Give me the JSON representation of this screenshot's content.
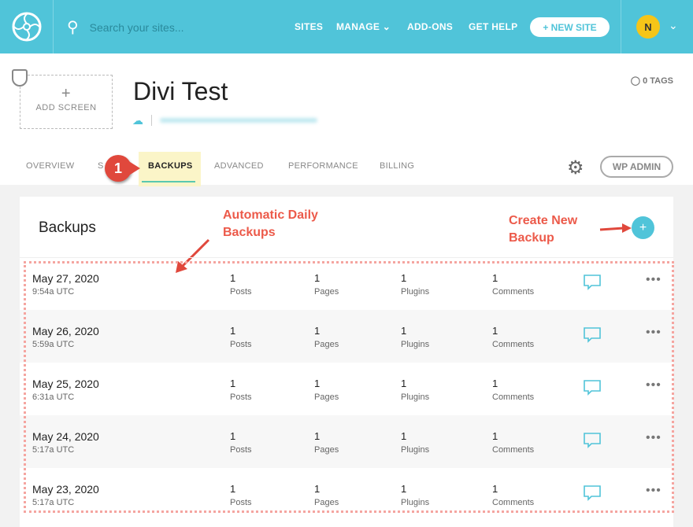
{
  "header": {
    "search_placeholder": "Search your sites...",
    "nav": [
      "SITES",
      "MANAGE",
      "ADD-ONS",
      "GET HELP"
    ],
    "new_site": "+ NEW SITE",
    "avatar": "N"
  },
  "site": {
    "add_screen": "ADD SCREEN",
    "title": "Divi Test",
    "tags": "0 TAGS"
  },
  "tabs": [
    "OVERVIEW",
    "S",
    "BACKUPS",
    "ADVANCED",
    "PERFORMANCE",
    "BILLING"
  ],
  "active_tab": "BACKUPS",
  "wp_admin": "WP ADMIN",
  "backups": {
    "title": "Backups",
    "rows": [
      {
        "date": "May 27, 2020",
        "time": "9:54a UTC",
        "posts": "1",
        "pages": "1",
        "plugins": "1",
        "comments": "1"
      },
      {
        "date": "May 26, 2020",
        "time": "5:59a UTC",
        "posts": "1",
        "pages": "1",
        "plugins": "1",
        "comments": "1"
      },
      {
        "date": "May 25, 2020",
        "time": "6:31a UTC",
        "posts": "1",
        "pages": "1",
        "plugins": "1",
        "comments": "1"
      },
      {
        "date": "May 24, 2020",
        "time": "5:17a UTC",
        "posts": "1",
        "pages": "1",
        "plugins": "1",
        "comments": "1"
      },
      {
        "date": "May 23, 2020",
        "time": "5:17a UTC",
        "posts": "1",
        "pages": "1",
        "plugins": "1",
        "comments": "1"
      }
    ],
    "labels": {
      "posts": "Posts",
      "pages": "Pages",
      "plugins": "Plugins",
      "comments": "Comments"
    }
  },
  "annotations": {
    "step": "1",
    "auto": "Automatic Daily Backups",
    "create": "Create New Backup"
  },
  "colors": {
    "brand": "#50c4d9",
    "annotation": "#ec5a4a"
  }
}
